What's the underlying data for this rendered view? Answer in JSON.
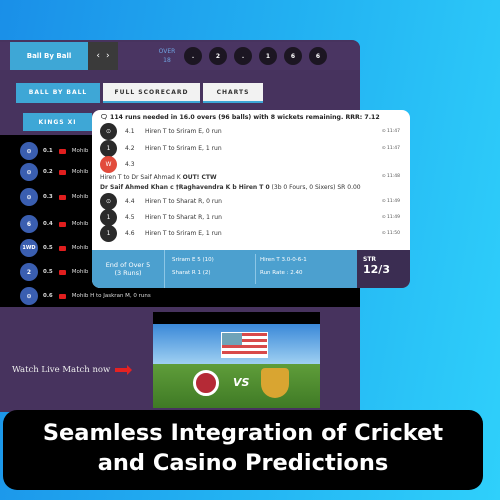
{
  "header": {
    "ball_by_ball_tab": "Ball By Ball",
    "prev": "‹",
    "next": "›",
    "over_label": "OVER",
    "over_number": "18",
    "recent_balls": [
      ".",
      "2",
      ".",
      "1",
      "6",
      "6"
    ]
  },
  "tabs": [
    {
      "label": "BALL BY BALL",
      "active": true
    },
    {
      "label": "FULL SCORECARD",
      "active": false
    },
    {
      "label": "CHARTS",
      "active": false
    }
  ],
  "team_tab": "KINGS XI",
  "left_list": [
    {
      "ball": "⊙",
      "over": "0.1",
      "text": "Mohib"
    },
    {
      "ball": "⊙",
      "over": "0.2",
      "text": "Mohib"
    },
    {
      "ball": "⊙",
      "over": "0.3",
      "text": "Mohib"
    },
    {
      "ball": "6",
      "over": "0.4",
      "text": "Mohib"
    },
    {
      "ball": "1WD",
      "over": "0.5",
      "text": "Mohib"
    },
    {
      "ball": "2",
      "over": "0.5",
      "text": "Mohib"
    },
    {
      "ball": "⊙",
      "over": "0.6",
      "text": "Mohib H to Jaskran M, 0 runs"
    }
  ],
  "commentary": {
    "summary": "114 runs needed in 16.0 overs (96 balls) with 8 wickets remaining. RRR: 7.12",
    "balls": [
      {
        "ball": "⊙",
        "over": "4.1",
        "text": "Hiren T to Sriram E, 0 run",
        "time": "11:47"
      },
      {
        "ball": "1",
        "over": "4.2",
        "text": "Hiren T to Sriram E, 1 run",
        "time": "11:47"
      },
      {
        "ball": "W",
        "over": "4.3",
        "text": "",
        "time": ""
      },
      {
        "ball": "⊙",
        "over": "4.4",
        "text": "Hiren T to Sharat R, 0 run",
        "time": "11:49"
      },
      {
        "ball": "1",
        "over": "4.5",
        "text": "Hiren T to Sharat R, 1 run",
        "time": "11:49"
      },
      {
        "ball": "1",
        "over": "4.6",
        "text": "Hiren T to Sriram E, 1 run",
        "time": "11:50"
      }
    ],
    "wicket_line": "Hiren T to Dr Saif Ahmad K",
    "wicket_out": "OUT! CTW",
    "wicket_time": "11:48",
    "dismissal_bold": "Dr Saif Ahmed Khan  c †Raghavendra K b Hiren T  0",
    "dismissal_detail": "(3b 0 Fours, 0 Sixers) SR 0.00"
  },
  "over_summary": {
    "title": "End of Over 5",
    "runs": "(3 Runs)",
    "batter1": "Sriram E 5 (10)",
    "batter2": "Sharat R 1 (2)",
    "bowler": "Hiren T 3.0-0-6-1",
    "run_rate": "Run Rate : 2.40",
    "team_label": "STR",
    "score": "12/3"
  },
  "watch_live": "Watch Live Match now",
  "caption": {
    "line1": "Seamless Integration of Cricket",
    "line2": "and Casino Predictions"
  },
  "colors": {
    "accent": "#3ea7d6",
    "panel": "#47335e",
    "wicket": "#e24b3b"
  }
}
